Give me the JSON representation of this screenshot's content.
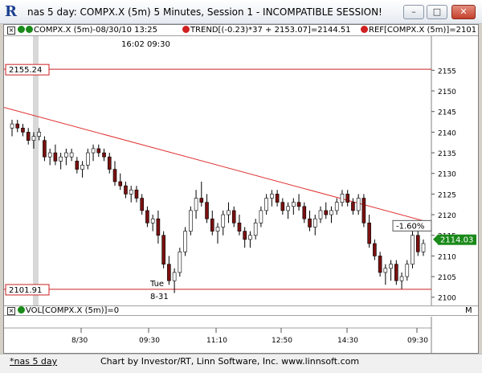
{
  "window": {
    "title": "nas 5 day: COMPX.X (5m) 5 Minutes, Session 1 - INCOMPATIBLE SESSION!",
    "minimize": "–",
    "maximize": "□",
    "close": "✕"
  },
  "legend": {
    "symbol": "COMPX.X (5m)-08/30/10 13:25",
    "trend": "TREND[(-0.23)*37 + 2153.07]=2144.51",
    "ref": "REF[COMPX.X (5m)]=2101",
    "time_readout": "16:02  09:30"
  },
  "price_axis": {
    "ticks": [
      "2155",
      "2150",
      "2145",
      "2140",
      "2135",
      "2130",
      "2125",
      "2120",
      "2115",
      "2110",
      "2105",
      "2100"
    ],
    "ref_high": "2155.24",
    "ref_low": "2101.91",
    "last_price": "2114.03",
    "trend_pct": "-1.60%"
  },
  "session_marker": {
    "day": "Tue",
    "date": "8-31"
  },
  "volume": {
    "label": "VOL[COMPX.X (5m)]=0",
    "ops": "M"
  },
  "time_axis": {
    "ticks": [
      "8/30",
      "09:30",
      "11:10",
      "12:50",
      "14:30",
      "09:30"
    ]
  },
  "status": {
    "tab": "*nas 5 day",
    "credit": "Chart by Investor/RT, Linn Software, Inc. www.linnsoft.com"
  },
  "colors": {
    "up": "#ffffff",
    "down": "#7a1010",
    "trend": "#e03030",
    "ref": "#cc2222",
    "last": "#1a8a1a"
  },
  "chart_data": {
    "type": "candlestick",
    "title": "",
    "ylim": [
      2098,
      2158
    ],
    "ref_lines": [
      2155.24,
      2101.91
    ],
    "trend_line": {
      "start": 2146.0,
      "end": 2118.0
    },
    "bars": [
      [
        2141,
        2143,
        2139,
        2142
      ],
      [
        2142,
        2143,
        2140,
        2141
      ],
      [
        2141,
        2142,
        2139,
        2140
      ],
      [
        2140,
        2141,
        2137,
        2138
      ],
      [
        2138,
        2140,
        2136,
        2139
      ],
      [
        2139,
        2141,
        2138,
        2140
      ],
      [
        2138,
        2139,
        2133,
        2134
      ],
      [
        2134,
        2136,
        2132,
        2135
      ],
      [
        2135,
        2137,
        2132,
        2133
      ],
      [
        2133,
        2135,
        2131,
        2134
      ],
      [
        2134,
        2136,
        2132,
        2135
      ],
      [
        2134,
        2136,
        2133,
        2135
      ],
      [
        2133,
        2134,
        2130,
        2131
      ],
      [
        2131,
        2133,
        2129,
        2132
      ],
      [
        2132,
        2136,
        2131,
        2135
      ],
      [
        2135,
        2137,
        2133,
        2136
      ],
      [
        2136,
        2137,
        2134,
        2135
      ],
      [
        2135,
        2136,
        2133,
        2134
      ],
      [
        2134,
        2135,
        2130,
        2131
      ],
      [
        2131,
        2133,
        2127,
        2128
      ],
      [
        2128,
        2130,
        2126,
        2127
      ],
      [
        2127,
        2128,
        2124,
        2125
      ],
      [
        2125,
        2127,
        2123,
        2126
      ],
      [
        2126,
        2127,
        2123,
        2124
      ],
      [
        2124,
        2125,
        2120,
        2121
      ],
      [
        2121,
        2122,
        2117,
        2118
      ],
      [
        2118,
        2120,
        2116,
        2119
      ],
      [
        2119,
        2121,
        2113,
        2115
      ],
      [
        2115,
        2116,
        2107,
        2108
      ],
      [
        2108,
        2110,
        2103,
        2104
      ],
      [
        2104,
        2107,
        2101,
        2106
      ],
      [
        2106,
        2112,
        2105,
        2111
      ],
      [
        2111,
        2117,
        2110,
        2116
      ],
      [
        2116,
        2122,
        2115,
        2121
      ],
      [
        2121,
        2126,
        2119,
        2124
      ],
      [
        2124,
        2128,
        2122,
        2123
      ],
      [
        2123,
        2125,
        2118,
        2119
      ],
      [
        2119,
        2121,
        2115,
        2116
      ],
      [
        2116,
        2118,
        2113,
        2117
      ],
      [
        2117,
        2121,
        2115,
        2120
      ],
      [
        2120,
        2123,
        2118,
        2121
      ],
      [
        2121,
        2122,
        2117,
        2118
      ],
      [
        2118,
        2120,
        2115,
        2116
      ],
      [
        2116,
        2117,
        2112,
        2114
      ],
      [
        2114,
        2116,
        2112,
        2115
      ],
      [
        2115,
        2119,
        2114,
        2118
      ],
      [
        2118,
        2122,
        2117,
        2121
      ],
      [
        2121,
        2125,
        2120,
        2124
      ],
      [
        2124,
        2126,
        2122,
        2125
      ],
      [
        2125,
        2126,
        2122,
        2123
      ],
      [
        2123,
        2124,
        2120,
        2121
      ],
      [
        2121,
        2123,
        2119,
        2122
      ],
      [
        2122,
        2124,
        2120,
        2123
      ],
      [
        2123,
        2125,
        2121,
        2122
      ],
      [
        2122,
        2123,
        2118,
        2119
      ],
      [
        2119,
        2121,
        2116,
        2117
      ],
      [
        2117,
        2120,
        2115,
        2119
      ],
      [
        2119,
        2122,
        2118,
        2121
      ],
      [
        2121,
        2123,
        2119,
        2120
      ],
      [
        2120,
        2122,
        2118,
        2121
      ],
      [
        2121,
        2124,
        2120,
        2123
      ],
      [
        2123,
        2126,
        2122,
        2125
      ],
      [
        2125,
        2126,
        2122,
        2123
      ],
      [
        2123,
        2124,
        2120,
        2121
      ],
      [
        2121,
        2125,
        2120,
        2124
      ],
      [
        2124,
        2125,
        2117,
        2118
      ],
      [
        2118,
        2120,
        2112,
        2113
      ],
      [
        2113,
        2114,
        2109,
        2110
      ],
      [
        2110,
        2111,
        2105,
        2106
      ],
      [
        2106,
        2108,
        2103,
        2107
      ],
      [
        2107,
        2109,
        2104,
        2108
      ],
      [
        2108,
        2109,
        2103,
        2104
      ],
      [
        2104,
        2106,
        2102,
        2105
      ],
      [
        2105,
        2109,
        2104,
        2108
      ],
      [
        2108,
        2116,
        2107,
        2115
      ],
      [
        2115,
        2117,
        2110,
        2111
      ],
      [
        2111,
        2114,
        2110,
        2113
      ]
    ]
  }
}
